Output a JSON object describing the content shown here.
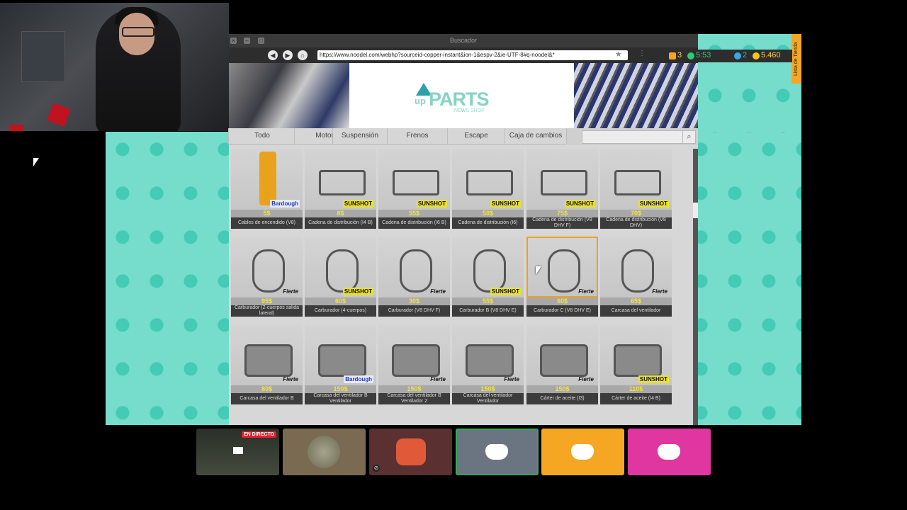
{
  "browser": {
    "window_title": "Buscador",
    "url": "https://www.noodel.com/webhp?sourceid-copper-instant&ion-1&espv-2&ie-UTF-8#q-noodel&*",
    "nav": {
      "back": "◀",
      "forward": "▶",
      "home": "⌂"
    }
  },
  "hud": {
    "counter_a": "3",
    "counter_b": "5:53",
    "counter_c": "2",
    "money": "5.460",
    "side_tab": "Lista de Tienda"
  },
  "site": {
    "brand_up": "up",
    "brand_parts": "PARTS",
    "brand_sub": "NEWS SHOP",
    "categories": [
      "Todo",
      "Motor",
      "Suspensión",
      "Frenos",
      "Escape",
      "Caja de cambios"
    ],
    "search_placeholder": ""
  },
  "products": [
    {
      "name": "Cables de encendido (V8)",
      "price": "5$",
      "brand": "Bardough"
    },
    {
      "name": "Cadena de distribución (I4 B)",
      "price": "8$",
      "brand": "SUNSHOT"
    },
    {
      "name": "Cadena de distribución (I6 B)",
      "price": "55$",
      "brand": "SUNSHOT"
    },
    {
      "name": "Cadena de distribución (I6)",
      "price": "50$",
      "brand": "SUNSHOT"
    },
    {
      "name": "Cadena de distribución (V8 DHV F)",
      "price": "75$",
      "brand": "SUNSHOT"
    },
    {
      "name": "Cadena de distribución (V8 DHV)",
      "price": "70$",
      "brand": "SUNSHOT"
    },
    {
      "name": "Carburador (2-cuerpos salida lateral)",
      "price": "95$",
      "brand": "Fierte"
    },
    {
      "name": "Carburador (4-cuerpos)",
      "price": "60$",
      "brand": "SUNSHOT"
    },
    {
      "name": "Carburador (V8 DHV F)",
      "price": "30$",
      "brand": "Fierte"
    },
    {
      "name": "Carburador B (V8 DHV E)",
      "price": "55$",
      "brand": "SUNSHOT"
    },
    {
      "name": "Carburador C (V8 DHV E)",
      "price": "60$",
      "brand": "Fierte"
    },
    {
      "name": "Carcasa del ventilador",
      "price": "65$",
      "brand": "Fierte"
    },
    {
      "name": "Carcasa del ventilador B",
      "price": "80$",
      "brand": "Fierte"
    },
    {
      "name": "Carcasa del ventilador B Ventilador",
      "price": "150$",
      "brand": "Bardough"
    },
    {
      "name": "Carcasa del ventilador B Ventilador 2",
      "price": "150$",
      "brand": "Fierte"
    },
    {
      "name": "Carcasa del ventilador Ventilador",
      "price": "150$",
      "brand": "Fierte"
    },
    {
      "name": "Cárter de aceite (I3)",
      "price": "150$",
      "brand": "Fierte"
    },
    {
      "name": "Cárter de aceite (I4 B)",
      "price": "110$",
      "brand": "SUNSHOT"
    }
  ],
  "stream": {
    "live_label": "EN DIRECTO"
  },
  "colors": {
    "desktop_bg": "#76dccc",
    "accent": "#f5a623",
    "tile_gray": "#6b7481",
    "tile_orange": "#f5a623",
    "tile_pink": "#e0369f"
  }
}
